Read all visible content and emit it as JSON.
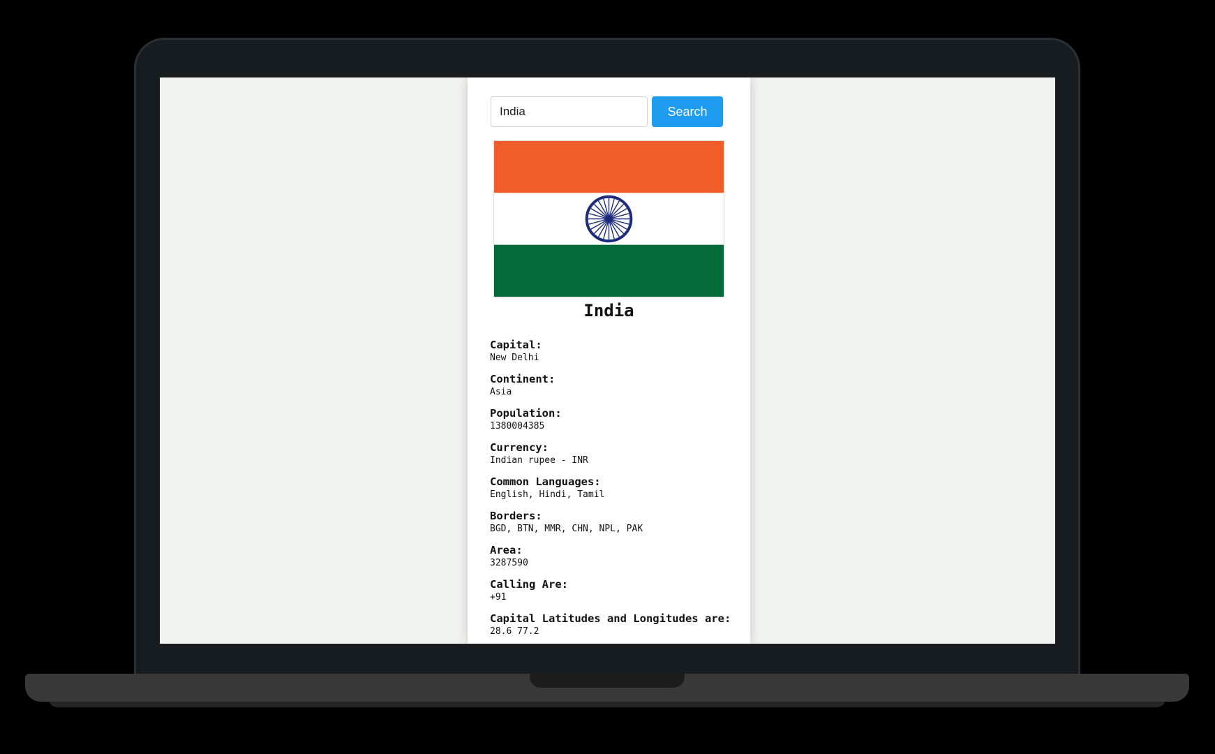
{
  "search": {
    "value": "India",
    "button_label": "Search"
  },
  "country": {
    "name": "India",
    "flag_colors": {
      "saffron": "#f05d28",
      "white": "#ffffff",
      "green": "#046a38",
      "chakra": "#1b2a7a"
    }
  },
  "details": [
    {
      "label": "Capital:",
      "value": "New Delhi"
    },
    {
      "label": "Continent:",
      "value": "Asia"
    },
    {
      "label": "Population:",
      "value": "1380004385"
    },
    {
      "label": "Currency:",
      "value": "Indian rupee - INR"
    },
    {
      "label": "Common Languages:",
      "value": "English, Hindi, Tamil"
    },
    {
      "label": "Borders:",
      "value": "BGD, BTN, MMR, CHN, NPL, PAK"
    },
    {
      "label": "Area:",
      "value": "3287590"
    },
    {
      "label": "Calling Are:",
      "value": "+91"
    },
    {
      "label": "Capital Latitudes and Longitudes are:",
      "value": "28.6 77.2"
    }
  ],
  "colors": {
    "accent": "#1e9cf0",
    "page_background": "#f1f3f0"
  }
}
